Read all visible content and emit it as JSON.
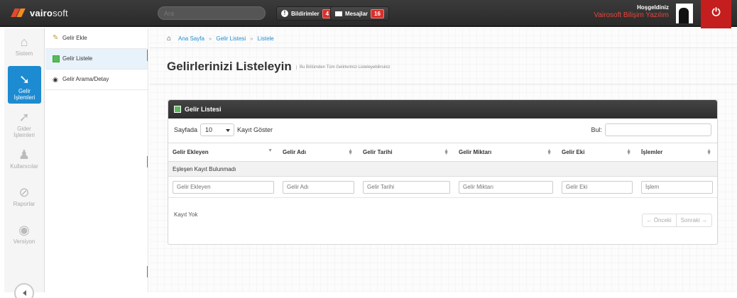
{
  "topbar": {
    "logo_a": "vairo",
    "logo_b": "soft",
    "search_placeholder": "Ara",
    "notifications": {
      "label": "Bildirimler",
      "count": "4"
    },
    "messages": {
      "label": "Mesajlar",
      "count": "16"
    },
    "greeting": "Hoşgeldiniz",
    "company": "Vairosoft Bilişim Yazılım",
    "power_icon": "power-icon"
  },
  "sidebar": {
    "items": [
      {
        "label": "Sistem",
        "icon": "home-icon"
      },
      {
        "label": "Gelir\nİşlemleri",
        "icon": "arrow-down-icon"
      },
      {
        "label": "Gider\nİşlemleri",
        "icon": "arrow-up-icon"
      },
      {
        "label": "Kullanıcılar",
        "icon": "user-add-icon"
      },
      {
        "label": "Raporlar",
        "icon": "paperclip-icon"
      },
      {
        "label": "Versiyon",
        "icon": "toggle-icon"
      }
    ]
  },
  "submenu": {
    "items": [
      {
        "label": "Gelir Ekle",
        "icon": "wand-icon"
      },
      {
        "label": "Gelir Listele",
        "icon": "table-icon"
      },
      {
        "label": "Gelir Arama/Detay",
        "icon": "eye-icon"
      }
    ]
  },
  "breadcrumb": [
    "Ana Sayfa",
    "Gelir Listesi",
    "Listele"
  ],
  "page": {
    "title": "Gelirlerinizi Listeleyin",
    "subtitle": "Bu Bölümden Tüm Gelirlerinizi Listeleyebilirsiniz"
  },
  "panel": {
    "title": "Gelir Listesi",
    "show_prefix": "Sayfada",
    "page_size": "10",
    "show_suffix": "Kayıt Göster",
    "find_label": "Bul:",
    "columns": [
      "Gelir Ekleyen",
      "Gelir Adı",
      "Gelir Tarihi",
      "Gelir Miktarı",
      "Gelir Eki",
      "İşlemler"
    ],
    "empty_message": "Eşleşen Kayıt Bulunmadı",
    "filters": [
      "Gelir Ekleyen",
      "Gelir Adı",
      "Gelir Tarihi",
      "Gelir Miktarı",
      "Gelir Eki",
      "İşlem"
    ],
    "footer_text": "Kayıt Yok",
    "prev": "← Önceki",
    "next": "Sonraki →"
  },
  "colors": {
    "accent": "#1d8bd1",
    "danger": "#c41e1e",
    "topbar": "#2f2f2f"
  }
}
